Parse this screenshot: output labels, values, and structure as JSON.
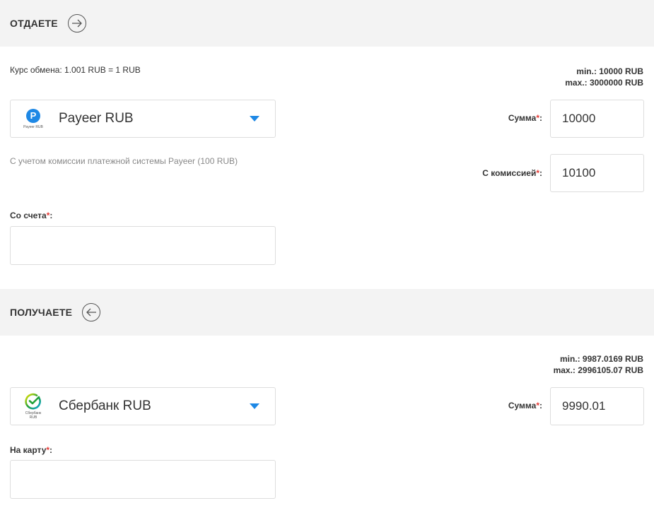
{
  "give": {
    "title": "ОТДАЕТЕ",
    "rate": "Курс обмена: 1.001 RUB = 1 RUB",
    "min": "min.: 10000 RUB",
    "max": "max.: 3000000 RUB",
    "currency": "Payeer RUB",
    "logo_letter": "P",
    "logo_caption": "Payeer RUB",
    "amount_label": "Сумма",
    "amount_value": "10000",
    "commission_label": "С комиссией",
    "commission_value": "10100",
    "note": "С учетом комиссии платежной системы Payeer (100 RUB)",
    "account_label": "Со счета",
    "account_value": ""
  },
  "receive": {
    "title": "ПОЛУЧАЕТЕ",
    "min": "min.: 9987.0169 RUB",
    "max": "max.: 2996105.07 RUB",
    "currency": "Сбербанк RUB",
    "logo_caption_1": "Сбербанк",
    "logo_caption_2": "RUB",
    "amount_label": "Сумма",
    "amount_value": "9990.01",
    "card_label": "На карту",
    "card_value": ""
  },
  "required_mark": "*",
  "colon": ":",
  "colors": {
    "header_bg": "#f3f3f3",
    "caret": "#1e88e5",
    "payeer": "#1e88e5",
    "sber": "#21a038",
    "required": "#e53935"
  },
  "icons": {
    "give_arrow": "arrow-right-circle-icon",
    "receive_arrow": "arrow-left-circle-icon",
    "dropdown": "caret-down-icon"
  }
}
